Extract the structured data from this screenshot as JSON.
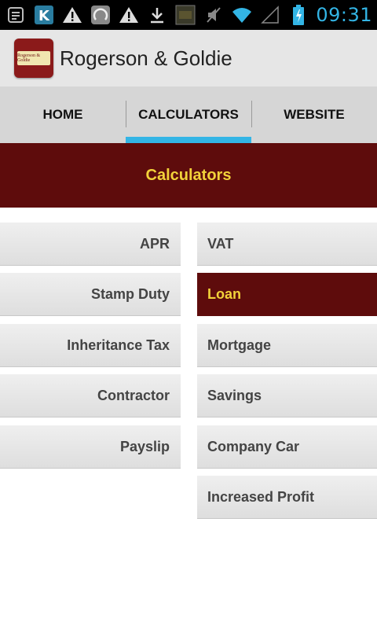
{
  "status_bar": {
    "time": "09:31",
    "accent_color": "#33b5e5",
    "icons": [
      "notification-icon",
      "k-app-icon",
      "warning-icon",
      "loading-icon",
      "warning-icon",
      "download-icon",
      "thumbnail-icon",
      "mute-icon",
      "wifi-icon",
      "signal-icon",
      "battery-icon"
    ]
  },
  "app": {
    "title": "Rogerson & Goldie",
    "logo_text": "Rogerson & Goldie"
  },
  "tabs": [
    {
      "label": "HOME",
      "active": false
    },
    {
      "label": "CALCULATORS",
      "active": true
    },
    {
      "label": "WEBSITE",
      "active": false
    }
  ],
  "section": {
    "title": "Calculators",
    "bg_color": "#5e0c0c",
    "text_color": "#f2d23a"
  },
  "calculators": {
    "left": [
      "APR",
      "Stamp Duty",
      "Inheritance Tax",
      "Contractor",
      "Payslip"
    ],
    "right": [
      "VAT",
      "Loan",
      "Mortgage",
      "Savings",
      "Company Car",
      "Increased Profit"
    ],
    "selected": "Loan"
  }
}
